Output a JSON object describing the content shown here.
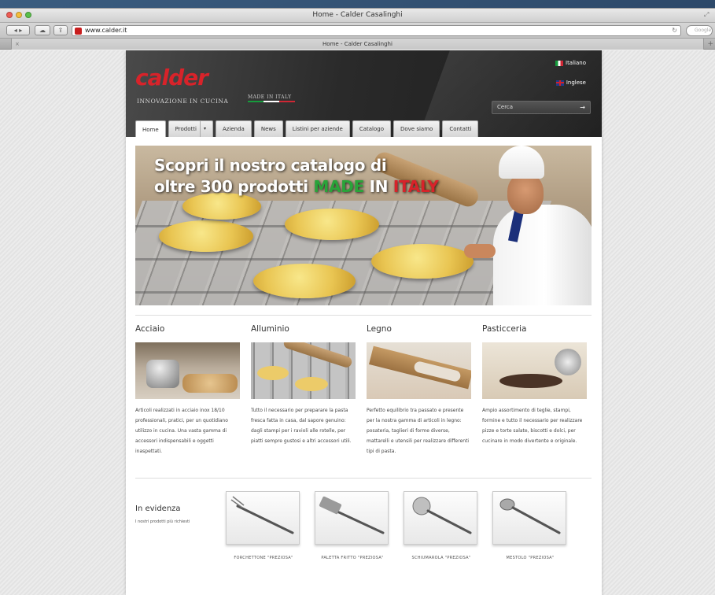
{
  "browser": {
    "window_title": "Home - Calder Casalinghi",
    "url": "www.calder.it",
    "search_placeholder": "Google",
    "tab_title": "Home - Calder Casalinghi"
  },
  "header": {
    "logo": "calder",
    "tagline": "INNOVAZIONE IN CUCINA",
    "made_in_italy": "MADE IN ITALY",
    "languages": [
      {
        "label": "Italiano",
        "flag": "flag-it-icon"
      },
      {
        "label": "Inglese",
        "flag": "flag-uk-icon"
      }
    ],
    "search_placeholder": "Cerca",
    "search_arrow": "→"
  },
  "nav": [
    {
      "label": "Home",
      "active": true
    },
    {
      "label": "Prodotti",
      "dropdown": true
    },
    {
      "label": "Azienda"
    },
    {
      "label": "News"
    },
    {
      "label": "Listini per aziende"
    },
    {
      "label": "Catalogo"
    },
    {
      "label": "Dove siamo"
    },
    {
      "label": "Contatti"
    }
  ],
  "hero": {
    "line1": "Scopri il nostro catalogo di",
    "line2_prefix": "oltre 300 prodotti ",
    "line2_made": "MADE",
    "line2_in": " IN ",
    "line2_italy": "ITALY"
  },
  "categories": [
    {
      "title": "Acciaio",
      "text": "Articoli realizzati in acciaio inox 18/10 professionali, pratici, per un quotidiano utilizzo in cucina. Una vasta gamma di accessori indispensabili e oggetti inaspettati."
    },
    {
      "title": "Alluminio",
      "text": "Tutto il necessario per preparare la pasta fresca fatta in casa, dal sapore genuino: dagli stampi per i ravioli alle rotelle, per piatti sempre gustosi e altri accessori utili."
    },
    {
      "title": "Legno",
      "text": "Perfetto equilibrio tra passato e presente per la nostra gamma di articoli in legno: posateria, taglieri di forme diverse, mattarelli e utensili per realizzare differenti tipi di pasta."
    },
    {
      "title": "Pasticceria",
      "text": "Ampio assortimento di teglie, stampi, formine e tutto il necessario per realizzare pizze e torte salate, biscotti e dolci, per cucinare in modo divertente e originale."
    }
  ],
  "featured": {
    "title": "In evidenza",
    "subtitle": "I nostri prodotti più richiesti",
    "products": [
      {
        "label": "FORCHETTONE \"PREZIOSA\"",
        "icon": "fork-icon"
      },
      {
        "label": "PALETTA FRITTO \"PREZIOSA\"",
        "icon": "spatula-icon"
      },
      {
        "label": "SCHIUMAROLA \"PREZIOSA\"",
        "icon": "skimmer-icon"
      },
      {
        "label": "MESTOLO \"PREZIOSA\"",
        "icon": "ladle-icon"
      }
    ]
  }
}
